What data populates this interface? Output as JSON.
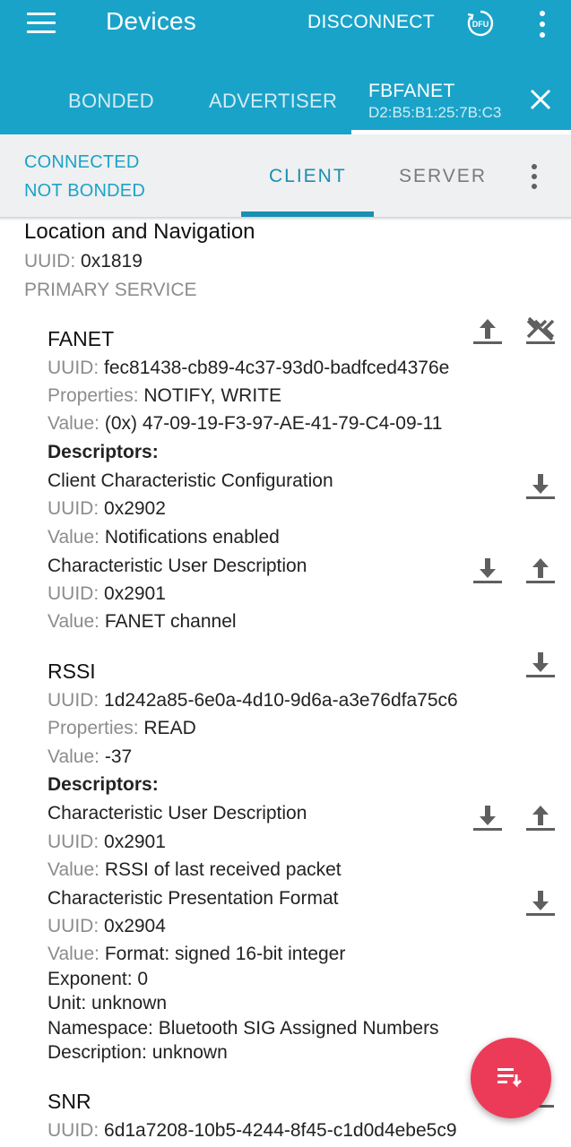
{
  "app": {
    "title": "Devices",
    "disconnect_label": "DISCONNECT",
    "dfu_label": "DFU",
    "accent_color": "#1aa3c9",
    "fab_color": "#ec3b58"
  },
  "tabs": {
    "bonded": "BONDED",
    "advertiser": "ADVERTISER",
    "device_name": "FBFANET",
    "device_address": "D2:B5:B1:25:7B:C3"
  },
  "connection": {
    "state": "CONNECTED",
    "bond_state": "NOT BONDED",
    "client_tab": "CLIENT",
    "server_tab": "SERVER"
  },
  "labels": {
    "uuid": "UUID:",
    "properties": "Properties:",
    "value": "Value:",
    "descriptors": "Descriptors:"
  },
  "service": {
    "name": "Location and Navigation",
    "uuid": "0x1819",
    "type": "PRIMARY SERVICE"
  },
  "characteristics": [
    {
      "name": "FANET",
      "uuid": "fec81438-cb89-4c37-93d0-badfced4376e",
      "properties": "NOTIFY, WRITE",
      "value": "(0x) 47-09-19-F3-97-AE-41-79-C4-09-11",
      "descriptors": [
        {
          "name": "Client Characteristic Configuration",
          "uuid": "0x2902",
          "value": "Notifications enabled"
        },
        {
          "name": "Characteristic User Description",
          "uuid": "0x2901",
          "value": "FANET channel"
        }
      ]
    },
    {
      "name": "RSSI",
      "uuid": "1d242a85-6e0a-4d10-9d6a-a3e76dfa75c6",
      "properties": "READ",
      "value": "-37",
      "descriptors": [
        {
          "name": "Characteristic User Description",
          "uuid": "0x2901",
          "value": "RSSI of last received packet"
        },
        {
          "name": "Characteristic Presentation Format",
          "uuid": "0x2904",
          "value": "Format: signed 16-bit integer",
          "extra": [
            "Exponent: 0",
            "Unit: unknown",
            "Namespace: Bluetooth SIG Assigned Numbers",
            "Description: unknown"
          ]
        }
      ]
    },
    {
      "name": "SNR",
      "uuid": "6d1a7208-10b5-4244-8f45-c1d0d4ebe5c9"
    }
  ],
  "icons": {
    "menu": "menu-icon",
    "dfu": "dfu-icon",
    "overflow": "more-vert-icon",
    "close": "close-icon",
    "read": "download-icon",
    "write": "upload-icon",
    "notify": "notifications-off-icon",
    "fab": "log-list-icon"
  }
}
